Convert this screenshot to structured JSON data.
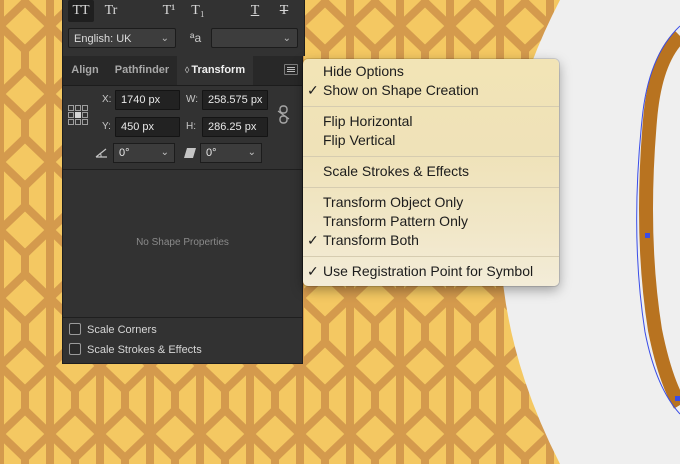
{
  "character": {
    "buttons": [
      "TT",
      "Tr",
      "T¹",
      "T₁",
      "T",
      "T"
    ],
    "language": "English: UK",
    "aa_label": "ªa",
    "antialias_value": ""
  },
  "panel": {
    "tabs": [
      "Align",
      "Pathfinder",
      "Transform"
    ],
    "active_tab_arrows": "◊",
    "x_label": "X:",
    "x_value": "1740 px",
    "y_label": "Y:",
    "y_value": "450 px",
    "w_label": "W:",
    "w_value": "258.575 px",
    "h_label": "H:",
    "h_value": "286.25 px",
    "rotate_value": "0°",
    "shear_value": "0°",
    "empty_message": "No Shape Properties",
    "scale_corners": "Scale Corners",
    "scale_strokes": "Scale Strokes & Effects"
  },
  "menu": {
    "check_glyph": "✓",
    "items": [
      {
        "label": "Hide Options",
        "checked": false
      },
      {
        "label": "Show on Shape Creation",
        "checked": true
      },
      {
        "label": "Flip Horizontal",
        "checked": false
      },
      {
        "label": "Flip Vertical",
        "checked": false
      },
      {
        "label": "Scale Strokes & Effects",
        "checked": false
      },
      {
        "label": "Transform Object Only",
        "checked": false
      },
      {
        "label": "Transform Pattern Only",
        "checked": false
      },
      {
        "label": "Transform Both",
        "checked": true
      },
      {
        "label": "Use Registration Point for Symbol",
        "checked": true
      }
    ]
  },
  "colors": {
    "pattern_fill": "#f4c862",
    "pattern_line": "#d49a4d",
    "canvas_grey": "#efefef",
    "ring": "#b87320",
    "selection": "#3a4de8"
  }
}
